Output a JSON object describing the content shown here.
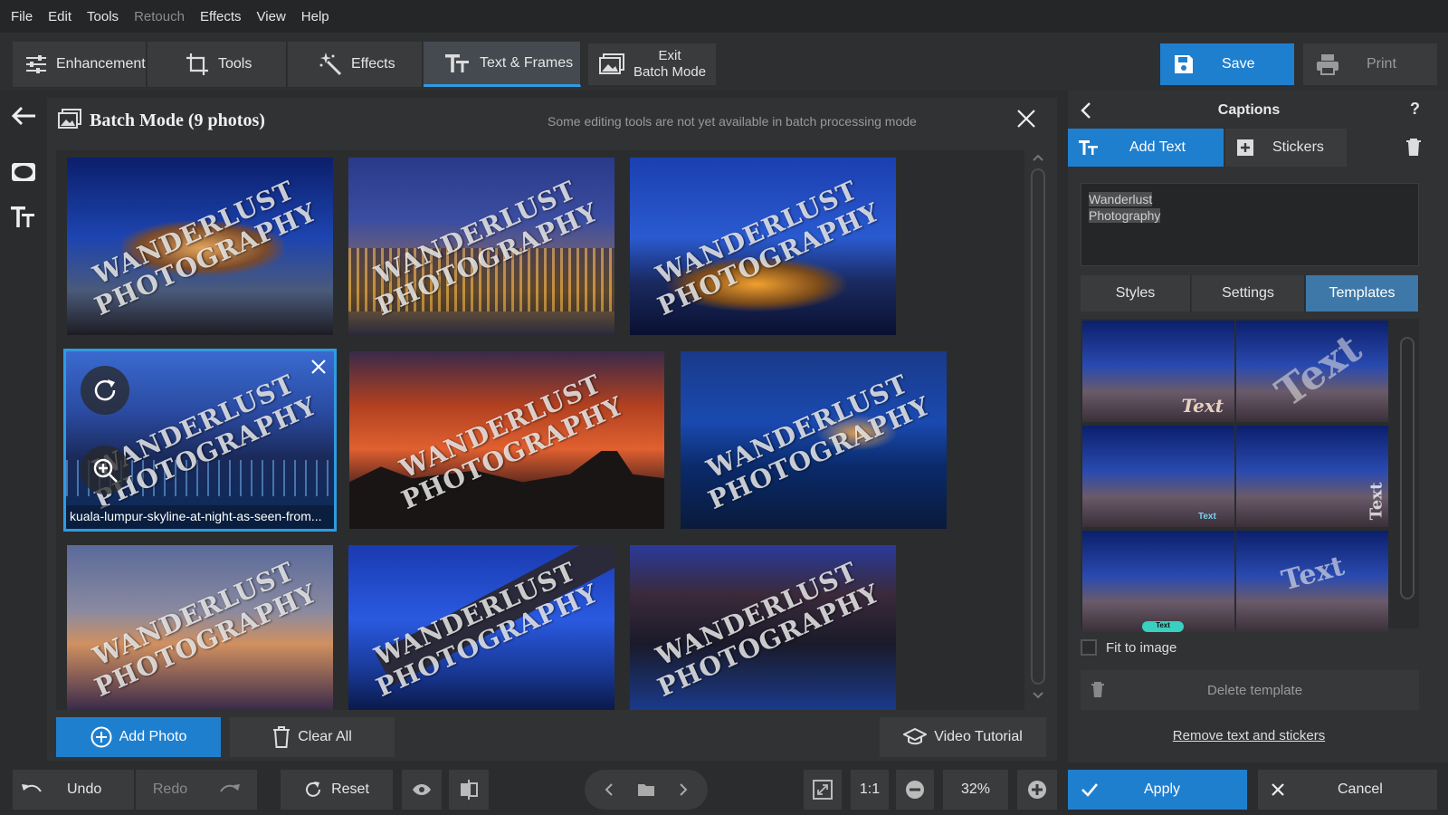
{
  "menu": [
    "File",
    "Edit",
    "Tools",
    "Retouch",
    "Effects",
    "View",
    "Help"
  ],
  "toolbar": {
    "tabs": [
      {
        "label": "Enhancement",
        "icon": "sliders-icon"
      },
      {
        "label": "Tools",
        "icon": "crop-icon"
      },
      {
        "label": "Effects",
        "icon": "magic-wand-icon"
      },
      {
        "label": "Text & Frames",
        "icon": "text-icon",
        "active": true
      }
    ],
    "exit_label_line1": "Exit",
    "exit_label_line2": "Batch Mode",
    "save_label": "Save",
    "print_label": "Print"
  },
  "main": {
    "title": "Batch Mode (9 photos)",
    "note": "Some editing tools are not yet available in batch processing mode",
    "watermark_line1": "WANDERLUST",
    "watermark_line2": "PHOTOGRAPHY",
    "selected_caption": "kuala-lumpur-skyline-at-night-as-seen-from...",
    "add_photo": "Add Photo",
    "clear_all": "Clear All",
    "video_tutorial": "Video Tutorial"
  },
  "statusbar": {
    "undo": "Undo",
    "redo": "Redo",
    "reset": "Reset",
    "ratio": "1:1",
    "zoom": "32%"
  },
  "right": {
    "title": "Captions",
    "help": "?",
    "add_text": "Add Text",
    "stickers": "Stickers",
    "text_line1": "Wanderlust",
    "text_line2": "Photography",
    "tabs": [
      "Styles",
      "Settings",
      "Templates"
    ],
    "fit_to_image": "Fit to image",
    "delete_template": "Delete template",
    "remove_link": "Remove text and stickers",
    "apply": "Apply",
    "cancel": "Cancel",
    "template_texts": [
      "Text",
      "Text",
      "Text",
      "Text",
      "Text",
      "Text"
    ]
  },
  "colors": {
    "accent": "#1f7fcf",
    "active_tab": "#3d78a8",
    "selection": "#2f9be0"
  }
}
